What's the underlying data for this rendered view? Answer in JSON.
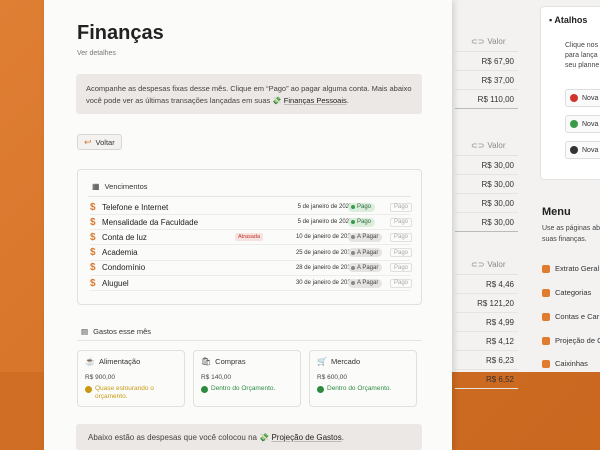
{
  "back_tables": {
    "header": "Valor",
    "table1": [
      "R$ 67,90",
      "R$ 37,00",
      "R$ 110,00"
    ],
    "table2": [
      "R$ 30,00",
      "R$ 30,00",
      "R$ 30,00",
      "R$ 30,00"
    ],
    "table3": [
      "R$ 4,46",
      "R$ 121,20",
      "R$ 4,99",
      "R$ 4,12",
      "R$ 6,23",
      "R$ 6,52"
    ]
  },
  "atalhos": {
    "title": "Atalhos",
    "desc": [
      "Clique nos",
      "para lança",
      "seu planne"
    ],
    "buttons": [
      "Nova",
      "Nova",
      "Nova"
    ]
  },
  "menu": {
    "title": "Menu",
    "desc": [
      "Use as páginas ab",
      "suas finanças."
    ],
    "items": [
      "Extrato Geral",
      "Categorias",
      "Contas e Car",
      "Projeção de G",
      "Caixinhas"
    ]
  },
  "page": {
    "title": "Finanças",
    "subtitle": "Ver detalhes",
    "callout_text": "Acompanhe as despesas fixas desse mês. Clique em “Pago” ao pagar alguma conta. Mais abaixo você pode ver as últimas transações lançadas em suas",
    "callout_link": "Finanças Pessoais",
    "callout_end": ".",
    "back_button": "Voltar"
  },
  "vencimentos": {
    "title": "Vencimentos",
    "rows": [
      {
        "name": "Telefone e Internet",
        "date": "5 de janeiro de 2025",
        "status": "Pago",
        "tag": ""
      },
      {
        "name": "Mensalidade da Faculdade",
        "date": "5 de janeiro de 2025",
        "status": "Pago",
        "tag": ""
      },
      {
        "name": "Conta de luz",
        "date": "10 de janeiro de 2025",
        "status": "A Pagar",
        "tag": "Atrasada"
      },
      {
        "name": "Academia",
        "date": "25 de janeiro de 2025",
        "status": "A Pagar",
        "tag": ""
      },
      {
        "name": "Condomínio",
        "date": "28 de janeiro de 2025",
        "status": "A Pagar",
        "tag": ""
      },
      {
        "name": "Aluguel",
        "date": "30 de janeiro de 2025",
        "status": "A Pagar",
        "tag": ""
      }
    ],
    "pay_button": "Pago"
  },
  "gastos": {
    "title": "Gastos esse mês",
    "cards": [
      {
        "name": "Alimentação",
        "value": "R$ 900,00",
        "status": "Quase estourando o orçamento.",
        "color": "#c79a12"
      },
      {
        "name": "Compras",
        "value": "R$ 140,00",
        "status": "Dentro do Orçamento.",
        "color": "#2d8a3e"
      },
      {
        "name": "Mercado",
        "value": "R$ 600,00",
        "status": "Dentro do Orçamento.",
        "color": "#2d8a3e"
      }
    ]
  },
  "bottom": {
    "text": "Abaixo estão as despesas que você colocou na",
    "link": "Projeção de Gastos",
    "end": "."
  },
  "colors": {
    "accent": "#d9782d",
    "paid": "#2d6b3a",
    "late": "#c0392b"
  }
}
